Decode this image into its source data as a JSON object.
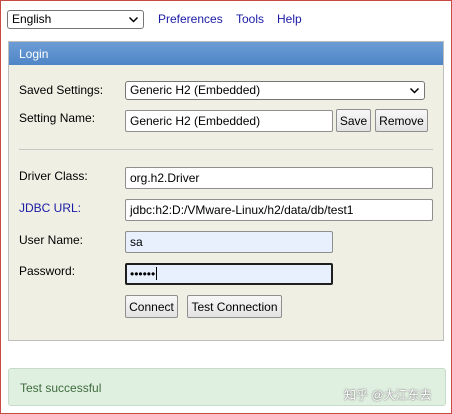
{
  "topbar": {
    "language": "English",
    "links": [
      "Preferences",
      "Tools",
      "Help"
    ]
  },
  "panel": {
    "title": "Login",
    "saved_settings_label": "Saved Settings:",
    "saved_settings_value": "Generic H2 (Embedded)",
    "setting_name_label": "Setting Name:",
    "setting_name_value": "Generic H2 (Embedded)",
    "save_label": "Save",
    "remove_label": "Remove",
    "driver_class_label": "Driver Class:",
    "driver_class_value": "org.h2.Driver",
    "jdbc_url_label": "JDBC URL:",
    "jdbc_url_value": "jdbc:h2:D:/VMware-Linux/h2/data/db/test1",
    "user_name_label": "User Name:",
    "user_name_value": "sa",
    "password_label": "Password:",
    "password_value": "••••••",
    "connect_label": "Connect",
    "test_connection_label": "Test Connection"
  },
  "status": {
    "message": "Test successful"
  },
  "watermark": "知乎 @大江东去",
  "colors": {
    "header_blue": "#5b8fcd",
    "panel_bg": "#efefe4",
    "link_blue": "#1a1aa6",
    "success_bg": "#e0f0e0",
    "success_text": "#3e6b3e"
  }
}
